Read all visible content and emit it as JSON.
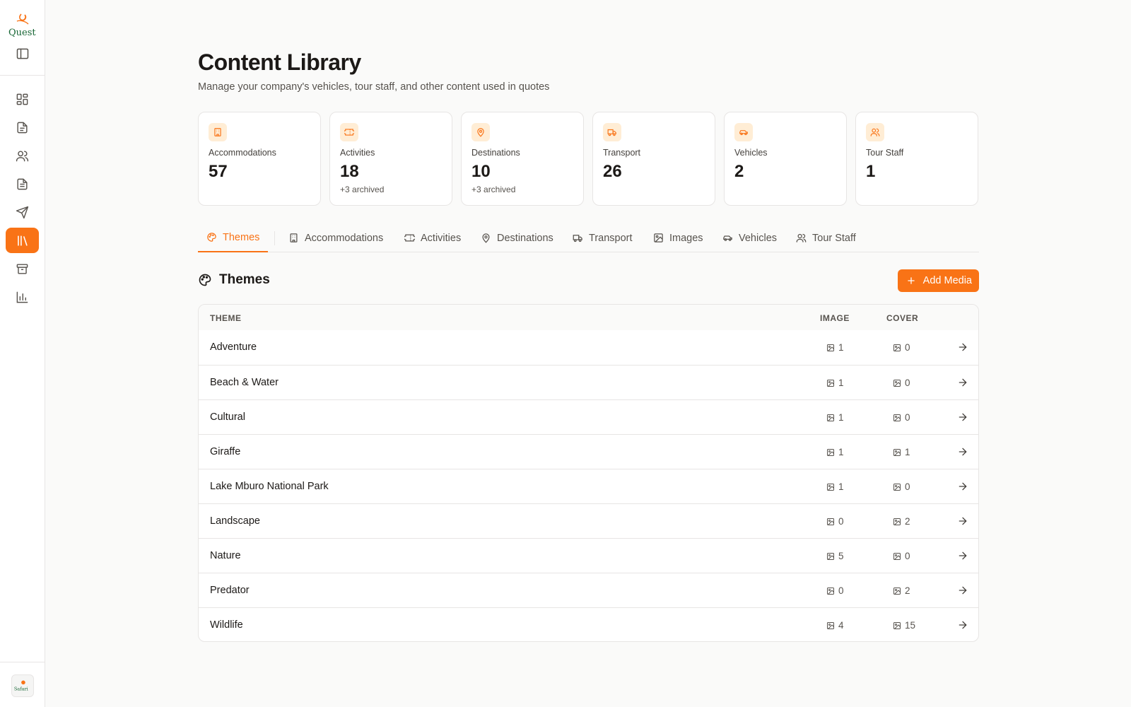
{
  "brand": {
    "logo_text": "Quest",
    "avatar_text": "Safari"
  },
  "sidebar": {
    "items": [
      {
        "icon": "dashboard-icon"
      },
      {
        "icon": "document-icon"
      },
      {
        "icon": "users-icon"
      },
      {
        "icon": "file-text-icon"
      },
      {
        "icon": "send-icon"
      },
      {
        "icon": "library-icon",
        "active": true
      },
      {
        "icon": "archive-icon"
      },
      {
        "icon": "bar-chart-icon"
      }
    ]
  },
  "header": {
    "title": "Content Library",
    "subtitle": "Manage your company's vehicles, tour staff, and other content used in quotes"
  },
  "stats": [
    {
      "label": "Accommodations",
      "value": "57",
      "sub": ""
    },
    {
      "label": "Activities",
      "value": "18",
      "sub": "+3 archived"
    },
    {
      "label": "Destinations",
      "value": "10",
      "sub": "+3 archived"
    },
    {
      "label": "Transport",
      "value": "26",
      "sub": ""
    },
    {
      "label": "Vehicles",
      "value": "2",
      "sub": ""
    },
    {
      "label": "Tour Staff",
      "value": "1",
      "sub": ""
    }
  ],
  "tabs": [
    {
      "label": "Themes",
      "active": true
    },
    {
      "label": "Accommodations"
    },
    {
      "label": "Activities"
    },
    {
      "label": "Destinations"
    },
    {
      "label": "Transport"
    },
    {
      "label": "Images"
    },
    {
      "label": "Vehicles"
    },
    {
      "label": "Tour Staff"
    }
  ],
  "section": {
    "title": "Themes",
    "add_label": "Add Media"
  },
  "table": {
    "columns": {
      "theme": "THEME",
      "image": "IMAGE",
      "cover": "COVER"
    },
    "rows": [
      {
        "name": "Adventure",
        "image": "1",
        "cover": "0"
      },
      {
        "name": "Beach & Water",
        "image": "1",
        "cover": "0"
      },
      {
        "name": "Cultural",
        "image": "1",
        "cover": "0"
      },
      {
        "name": "Giraffe",
        "image": "1",
        "cover": "1"
      },
      {
        "name": "Lake Mburo National Park",
        "image": "1",
        "cover": "0"
      },
      {
        "name": "Landscape",
        "image": "0",
        "cover": "2"
      },
      {
        "name": "Nature",
        "image": "5",
        "cover": "0"
      },
      {
        "name": "Predator",
        "image": "0",
        "cover": "2"
      },
      {
        "name": "Wildlife",
        "image": "4",
        "cover": "15"
      }
    ]
  },
  "colors": {
    "accent": "#f97316",
    "accent_soft": "#ffedd5",
    "border": "#e7e5e4"
  }
}
